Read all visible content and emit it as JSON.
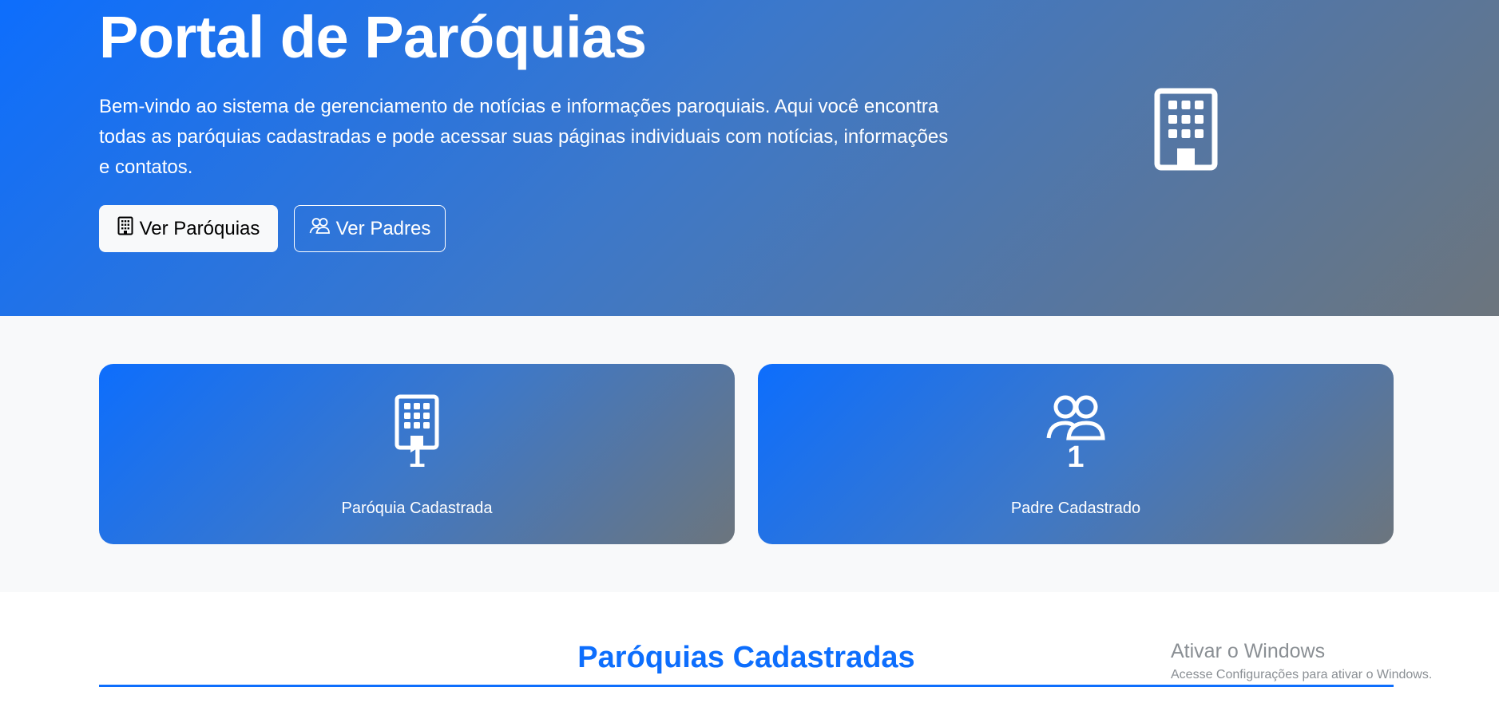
{
  "hero": {
    "title": "Portal de Paróquias",
    "lead": "Bem-vindo ao sistema de gerenciamento de notícias e informações paroquiais. Aqui você encontra todas as paróquias cadastradas e pode acessar suas páginas individuais com notícias, informações e contatos.",
    "buttons": {
      "parishes_label": "Ver Paróquias",
      "parishes_icon": "building-icon",
      "priests_label": "Ver Padres",
      "priests_icon": "people-icon"
    },
    "side_icon": "building-icon"
  },
  "stats": [
    {
      "icon": "building-icon",
      "value": "1",
      "label": "Paróquia Cadastrada"
    },
    {
      "icon": "people-icon",
      "value": "1",
      "label": "Padre Cadastrado"
    }
  ],
  "section": {
    "title": "Paróquias Cadastradas"
  },
  "windows_watermark": {
    "title": "Ativar o Windows",
    "subtitle": "Acesse Configurações para ativar o Windows."
  },
  "colors": {
    "primary": "#0d6efd",
    "secondary": "#6c757d",
    "light": "#f8f9fa"
  }
}
